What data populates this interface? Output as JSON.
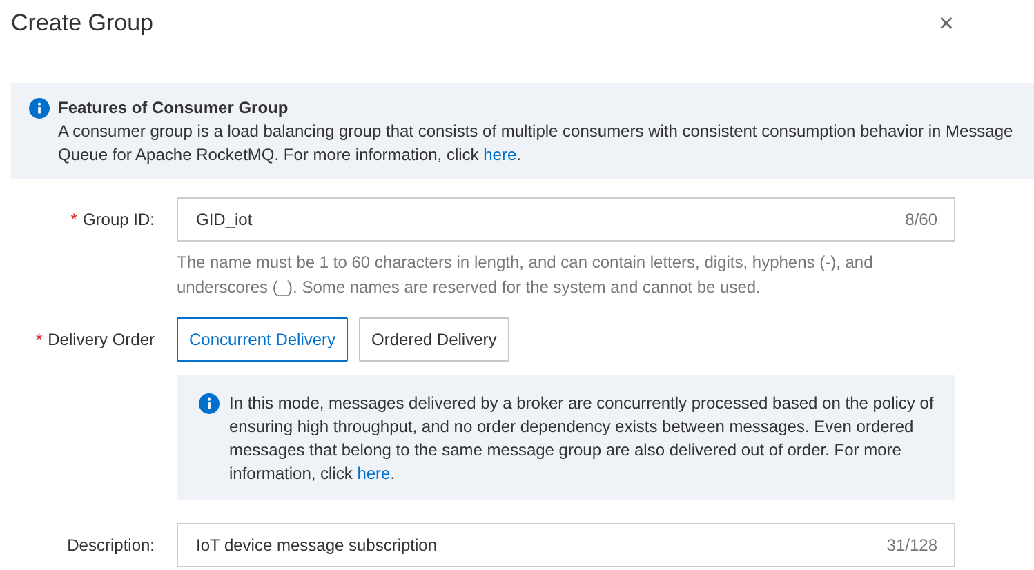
{
  "dialog": {
    "title": "Create Group",
    "close": "×"
  },
  "notice": {
    "title": "Features of Consumer Group",
    "text": "A consumer group is a load balancing group that consists of multiple consumers with consistent consumption behavior in Message Queue for Apache RocketMQ. For more information, click ",
    "link": "here",
    "suffix": "."
  },
  "group_id": {
    "required_mark": "*",
    "label": "Group ID:",
    "value": "GID_iot",
    "counter": "8/60",
    "hint": "The name must be 1 to 60 characters in length, and can contain letters, digits, hyphens (-), and underscores (_). Some names are reserved for the system and cannot be used."
  },
  "delivery_order": {
    "required_mark": "*",
    "label": "Delivery Order",
    "options": [
      {
        "label": "Concurrent Delivery",
        "selected": true
      },
      {
        "label": "Ordered Delivery",
        "selected": false
      }
    ],
    "info": {
      "text": "In this mode, messages delivered by a broker are concurrently processed based on the policy of ensuring high throughput, and no order dependency exists between messages. Even ordered messages that belong to the same message group are also delivered out of order. For more information, click ",
      "link": "here",
      "suffix": "."
    }
  },
  "description": {
    "label": "Description:",
    "value": "IoT device message subscription",
    "counter": "31/128"
  }
}
